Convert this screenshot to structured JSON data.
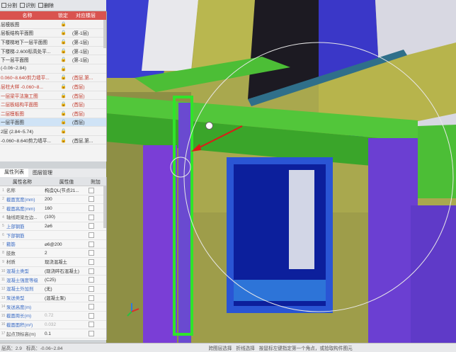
{
  "toolbar": {
    "items": [
      {
        "label": "分割",
        "icon": "split-icon"
      },
      {
        "label": "识别",
        "icon": "recognize-icon"
      },
      {
        "label": "删除",
        "icon": "delete-icon"
      }
    ]
  },
  "drawings": {
    "headers": [
      "名称",
      "锁定",
      "对应楼层"
    ],
    "rows": [
      {
        "name": "层模板图",
        "floor": "",
        "red": false
      },
      {
        "name": "层板结构平面图",
        "floor": "(第-1层)",
        "red": false
      },
      {
        "name": "下楼梯地下一层平面图",
        "floor": "(第-1层)",
        "red": false
      },
      {
        "name": "下楼梯-2.600标高处平...",
        "floor": "(第-1层)",
        "red": false
      },
      {
        "name": "下一层平面图",
        "floor": "(第-1层)",
        "red": false
      },
      {
        "name": "(-0.06~2.84)",
        "floor": "",
        "red": false
      },
      {
        "name": "0.060~8.640剪力墙平...",
        "floor": "(首层,第...",
        "red": true
      },
      {
        "name": "层柱大样 -0.060~8...",
        "floor": "(首层)",
        "red": true
      },
      {
        "name": "一层梁平法施工图",
        "floor": "(首层)",
        "red": true
      },
      {
        "name": "二层板结构平面图",
        "floor": "(首层)",
        "red": true
      },
      {
        "name": "二层模板图",
        "floor": "(首层)",
        "red": true
      },
      {
        "name": "一层平面图",
        "floor": "(首层)",
        "red": false,
        "selected": true
      },
      {
        "name": "2层 (2.84~5.74)",
        "floor": "",
        "red": false
      },
      {
        "name": "-0.060~8.640剪力墙平...",
        "floor": "(首层,第...",
        "red": false
      }
    ]
  },
  "properties": {
    "tabs": [
      "属性列表",
      "图层管理"
    ],
    "headers": [
      "属性名称",
      "属性值",
      "附加"
    ],
    "rows": [
      {
        "idx": "1",
        "name": "名称",
        "value": "构造QL(节点21...",
        "blue": false
      },
      {
        "idx": "2",
        "name": "截面宽度(mm)",
        "value": "200",
        "blue": true
      },
      {
        "idx": "3",
        "name": "截面高度(mm)",
        "value": "160",
        "blue": true
      },
      {
        "idx": "4",
        "name": "轴线距梁左边...",
        "value": "(100)",
        "blue": false
      },
      {
        "idx": "5",
        "name": "上部钢筋",
        "value": "2⌀6",
        "blue": true
      },
      {
        "idx": "6",
        "name": "下部钢筋",
        "value": "",
        "blue": true
      },
      {
        "idx": "7",
        "name": "箍筋",
        "value": "⌀6@200",
        "blue": true
      },
      {
        "idx": "8",
        "name": "肢数",
        "value": "2",
        "blue": false
      },
      {
        "idx": "9",
        "name": "材质",
        "value": "现浇混凝土",
        "blue": false
      },
      {
        "idx": "10",
        "name": "混凝土类型",
        "value": "(现浇碎石混凝土)",
        "blue": true
      },
      {
        "idx": "11",
        "name": "混凝土强度等级",
        "value": "(C25)",
        "blue": true
      },
      {
        "idx": "12",
        "name": "混凝土外加剂",
        "value": "(无)",
        "blue": true
      },
      {
        "idx": "13",
        "name": "泵送类型",
        "value": "(混凝土泵)",
        "blue": true
      },
      {
        "idx": "14",
        "name": "泵送高度(m)",
        "value": "",
        "blue": true
      },
      {
        "idx": "15",
        "name": "截面周长(m)",
        "value": "0.72",
        "blue": true,
        "grey": true
      },
      {
        "idx": "16",
        "name": "截面面积(m²)",
        "value": "0.032",
        "blue": true,
        "grey": true
      },
      {
        "idx": "17",
        "name": "起点顶标高(m)",
        "value": "0.1",
        "blue": false
      }
    ]
  },
  "status": {
    "items": [
      "层高：2.9",
      "标高：-0.06~2.84",
      "跨图层选择",
      "折线选择",
      "按鼠标左键指定第一个角点，或拾取构件图元"
    ]
  }
}
